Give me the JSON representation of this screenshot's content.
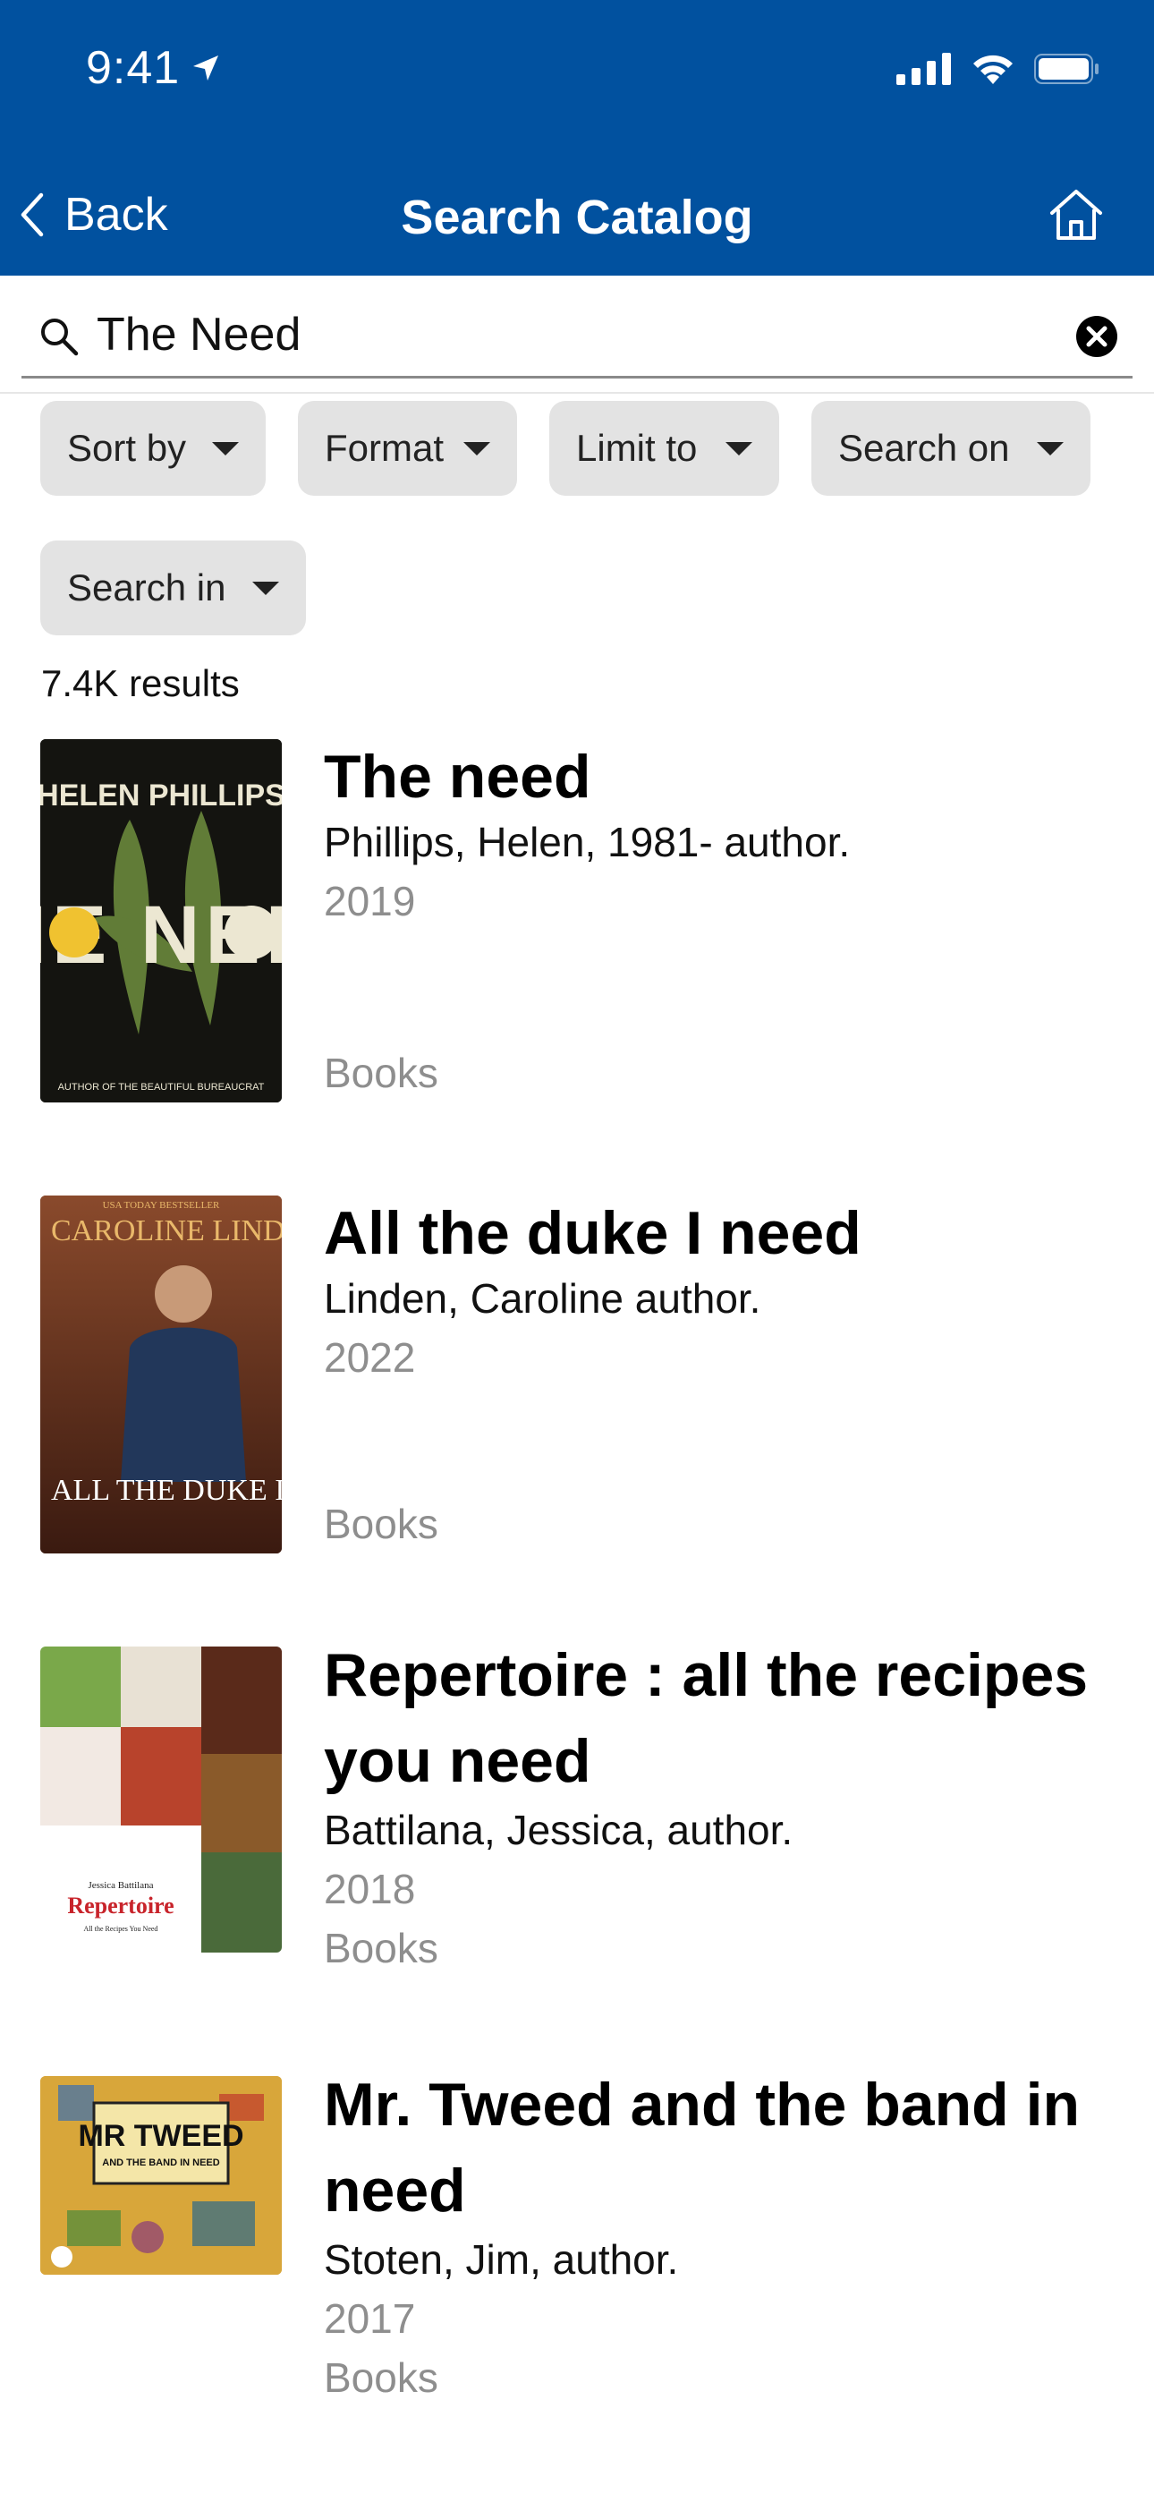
{
  "status_bar": {
    "time": "9:41"
  },
  "nav": {
    "back_label": "Back",
    "title": "Search Catalog"
  },
  "search": {
    "value": "The Need"
  },
  "filters": [
    "Sort by",
    "Format",
    "Limit to",
    "Search on",
    "Search in"
  ],
  "results_count": "7.4K results",
  "results": [
    {
      "title": "The need",
      "author": "Phillips, Helen, 1981- author.",
      "year": "2019",
      "format": "Books",
      "cover": {
        "author_text": "HELEN PHILLIPS",
        "title_text": "THE NEED",
        "footer_text": "AUTHOR OF THE BEAUTIFUL BUREAUCRAT",
        "colors": {
          "bg": "#141410",
          "text": "#ece7d2",
          "leaf": "#6f8f3e"
        }
      }
    },
    {
      "title": "All the duke I need",
      "author": "Linden, Caroline author.",
      "year": "2022",
      "format": "Books",
      "cover": {
        "top_text": "USA TODAY BESTSELLER",
        "author_text": "CAROLINE LINDEN",
        "title_text": "ALL THE DUKE I NEED",
        "colors": {
          "bg": "#6a3220",
          "accent": "#e9b86a"
        }
      }
    },
    {
      "title": "Repertoire : all the recipes you need",
      "author": "Battilana, Jessica, author.",
      "year": "2018",
      "format": "Books",
      "cover": {
        "author_text": "Jessica Battilana",
        "title_text": "Repertoire",
        "sub_text": "All the Recipes You Need",
        "colors": {
          "accent": "#c8242b"
        }
      }
    },
    {
      "title": "Mr. Tweed and the band in need",
      "author": "Stoten, Jim, author.",
      "year": "2017",
      "format": "Books",
      "cover": {
        "title_text": "MR TWEED",
        "sub_text": "AND THE BAND IN NEED",
        "colors": {
          "bg": "#d8a63a"
        }
      }
    }
  ],
  "colors": {
    "header": "#01519f",
    "chip": "#e3e3e3",
    "muted": "#8e8e8e"
  }
}
